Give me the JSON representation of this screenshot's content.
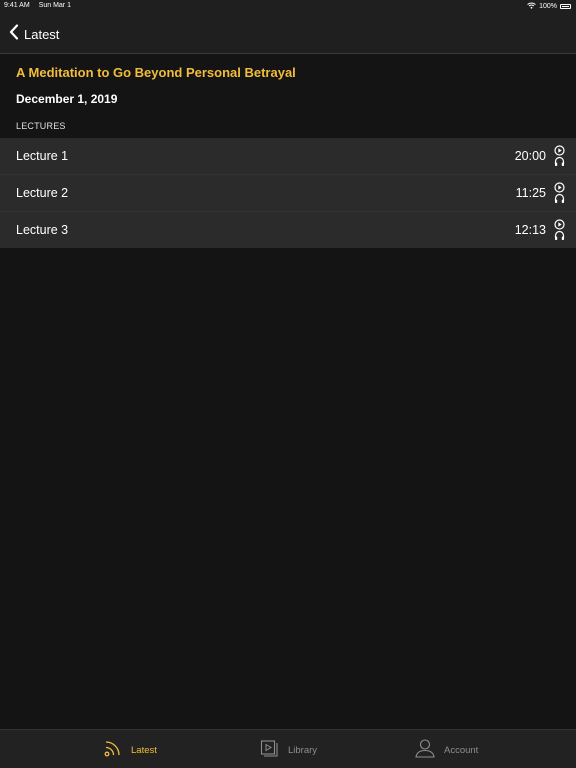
{
  "status_bar": {
    "time": "9:41 AM",
    "date": "Sun Mar 1",
    "battery": "100%"
  },
  "nav": {
    "back_label": "Latest"
  },
  "page": {
    "title": "A Meditation to Go Beyond Personal Betrayal",
    "date": "December 1, 2019",
    "section_header": "LECTURES"
  },
  "lectures": [
    {
      "title": "Lecture 1",
      "duration": "20:00"
    },
    {
      "title": "Lecture 2",
      "duration": "11:25"
    },
    {
      "title": "Lecture 3",
      "duration": "12:13"
    }
  ],
  "tabs": [
    {
      "label": "Latest",
      "icon": "rss-icon",
      "active": true
    },
    {
      "label": "Library",
      "icon": "library-icon",
      "active": false
    },
    {
      "label": "Account",
      "icon": "account-icon",
      "active": false
    }
  ],
  "colors": {
    "accent": "#f2bd3a",
    "background": "#141414",
    "row": "#2b2b2b"
  }
}
